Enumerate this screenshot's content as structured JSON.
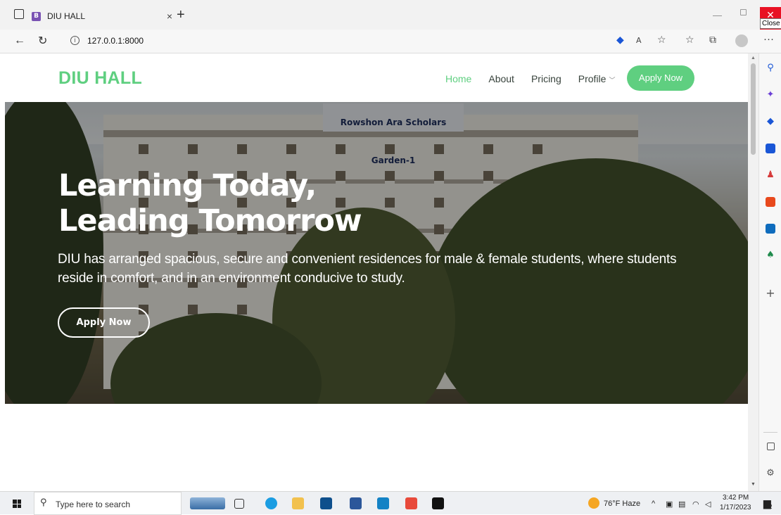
{
  "browser": {
    "tab_title": "DIU HALL",
    "tab_favicon_letter": "B",
    "tab_close": "×",
    "new_tab": "+",
    "url": "127.0.0.1:8000",
    "close_tooltip": "Close",
    "more": "···"
  },
  "site": {
    "logo": "DIU HALL",
    "nav": {
      "home": "Home",
      "about": "About",
      "pricing": "Pricing",
      "profile": "Profile",
      "apply": "Apply Now"
    },
    "hero": {
      "title_line1": "Learning Today,",
      "title_line2": "Leading Tomorrow",
      "description": "DIU has arranged spacious, secure and convenient residences for male & female students, where students reside in comfort, and in an environment conducive to study.",
      "button": "Apply Now",
      "sign_text": "Rowshon Ara Scholars Garden-1"
    }
  },
  "taskbar": {
    "search_placeholder": "Type here to search",
    "weather": "76°F  Haze",
    "time": "3:42 PM",
    "date": "1/17/2023",
    "notification_count": "2"
  },
  "colors": {
    "brand_green": "#5fcf80",
    "close_red": "#e81123"
  }
}
